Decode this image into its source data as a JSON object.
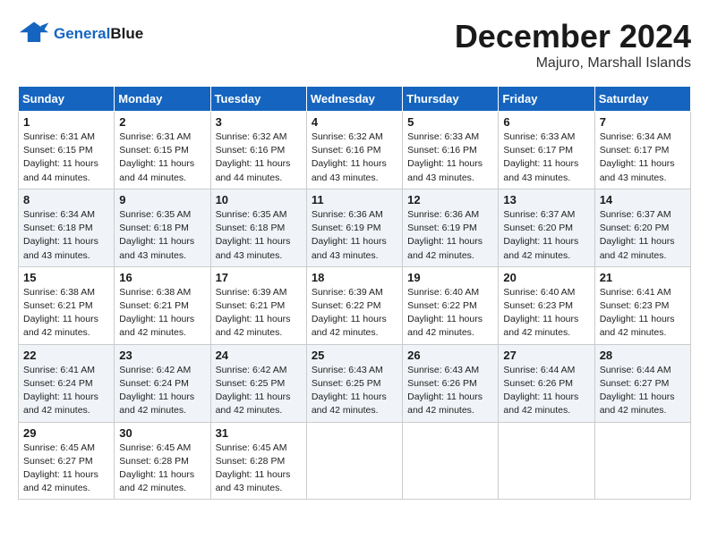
{
  "header": {
    "logo_line1": "General",
    "logo_line2": "Blue",
    "month_title": "December 2024",
    "location": "Majuro, Marshall Islands"
  },
  "days_of_week": [
    "Sunday",
    "Monday",
    "Tuesday",
    "Wednesday",
    "Thursday",
    "Friday",
    "Saturday"
  ],
  "weeks": [
    [
      {
        "day": "1",
        "sunrise": "6:31 AM",
        "sunset": "6:15 PM",
        "daylight": "11 hours and 44 minutes."
      },
      {
        "day": "2",
        "sunrise": "6:31 AM",
        "sunset": "6:15 PM",
        "daylight": "11 hours and 44 minutes."
      },
      {
        "day": "3",
        "sunrise": "6:32 AM",
        "sunset": "6:16 PM",
        "daylight": "11 hours and 44 minutes."
      },
      {
        "day": "4",
        "sunrise": "6:32 AM",
        "sunset": "6:16 PM",
        "daylight": "11 hours and 43 minutes."
      },
      {
        "day": "5",
        "sunrise": "6:33 AM",
        "sunset": "6:16 PM",
        "daylight": "11 hours and 43 minutes."
      },
      {
        "day": "6",
        "sunrise": "6:33 AM",
        "sunset": "6:17 PM",
        "daylight": "11 hours and 43 minutes."
      },
      {
        "day": "7",
        "sunrise": "6:34 AM",
        "sunset": "6:17 PM",
        "daylight": "11 hours and 43 minutes."
      }
    ],
    [
      {
        "day": "8",
        "sunrise": "6:34 AM",
        "sunset": "6:18 PM",
        "daylight": "11 hours and 43 minutes."
      },
      {
        "day": "9",
        "sunrise": "6:35 AM",
        "sunset": "6:18 PM",
        "daylight": "11 hours and 43 minutes."
      },
      {
        "day": "10",
        "sunrise": "6:35 AM",
        "sunset": "6:18 PM",
        "daylight": "11 hours and 43 minutes."
      },
      {
        "day": "11",
        "sunrise": "6:36 AM",
        "sunset": "6:19 PM",
        "daylight": "11 hours and 43 minutes."
      },
      {
        "day": "12",
        "sunrise": "6:36 AM",
        "sunset": "6:19 PM",
        "daylight": "11 hours and 42 minutes."
      },
      {
        "day": "13",
        "sunrise": "6:37 AM",
        "sunset": "6:20 PM",
        "daylight": "11 hours and 42 minutes."
      },
      {
        "day": "14",
        "sunrise": "6:37 AM",
        "sunset": "6:20 PM",
        "daylight": "11 hours and 42 minutes."
      }
    ],
    [
      {
        "day": "15",
        "sunrise": "6:38 AM",
        "sunset": "6:21 PM",
        "daylight": "11 hours and 42 minutes."
      },
      {
        "day": "16",
        "sunrise": "6:38 AM",
        "sunset": "6:21 PM",
        "daylight": "11 hours and 42 minutes."
      },
      {
        "day": "17",
        "sunrise": "6:39 AM",
        "sunset": "6:21 PM",
        "daylight": "11 hours and 42 minutes."
      },
      {
        "day": "18",
        "sunrise": "6:39 AM",
        "sunset": "6:22 PM",
        "daylight": "11 hours and 42 minutes."
      },
      {
        "day": "19",
        "sunrise": "6:40 AM",
        "sunset": "6:22 PM",
        "daylight": "11 hours and 42 minutes."
      },
      {
        "day": "20",
        "sunrise": "6:40 AM",
        "sunset": "6:23 PM",
        "daylight": "11 hours and 42 minutes."
      },
      {
        "day": "21",
        "sunrise": "6:41 AM",
        "sunset": "6:23 PM",
        "daylight": "11 hours and 42 minutes."
      }
    ],
    [
      {
        "day": "22",
        "sunrise": "6:41 AM",
        "sunset": "6:24 PM",
        "daylight": "11 hours and 42 minutes."
      },
      {
        "day": "23",
        "sunrise": "6:42 AM",
        "sunset": "6:24 PM",
        "daylight": "11 hours and 42 minutes."
      },
      {
        "day": "24",
        "sunrise": "6:42 AM",
        "sunset": "6:25 PM",
        "daylight": "11 hours and 42 minutes."
      },
      {
        "day": "25",
        "sunrise": "6:43 AM",
        "sunset": "6:25 PM",
        "daylight": "11 hours and 42 minutes."
      },
      {
        "day": "26",
        "sunrise": "6:43 AM",
        "sunset": "6:26 PM",
        "daylight": "11 hours and 42 minutes."
      },
      {
        "day": "27",
        "sunrise": "6:44 AM",
        "sunset": "6:26 PM",
        "daylight": "11 hours and 42 minutes."
      },
      {
        "day": "28",
        "sunrise": "6:44 AM",
        "sunset": "6:27 PM",
        "daylight": "11 hours and 42 minutes."
      }
    ],
    [
      {
        "day": "29",
        "sunrise": "6:45 AM",
        "sunset": "6:27 PM",
        "daylight": "11 hours and 42 minutes."
      },
      {
        "day": "30",
        "sunrise": "6:45 AM",
        "sunset": "6:28 PM",
        "daylight": "11 hours and 42 minutes."
      },
      {
        "day": "31",
        "sunrise": "6:45 AM",
        "sunset": "6:28 PM",
        "daylight": "11 hours and 43 minutes."
      },
      null,
      null,
      null,
      null
    ]
  ]
}
